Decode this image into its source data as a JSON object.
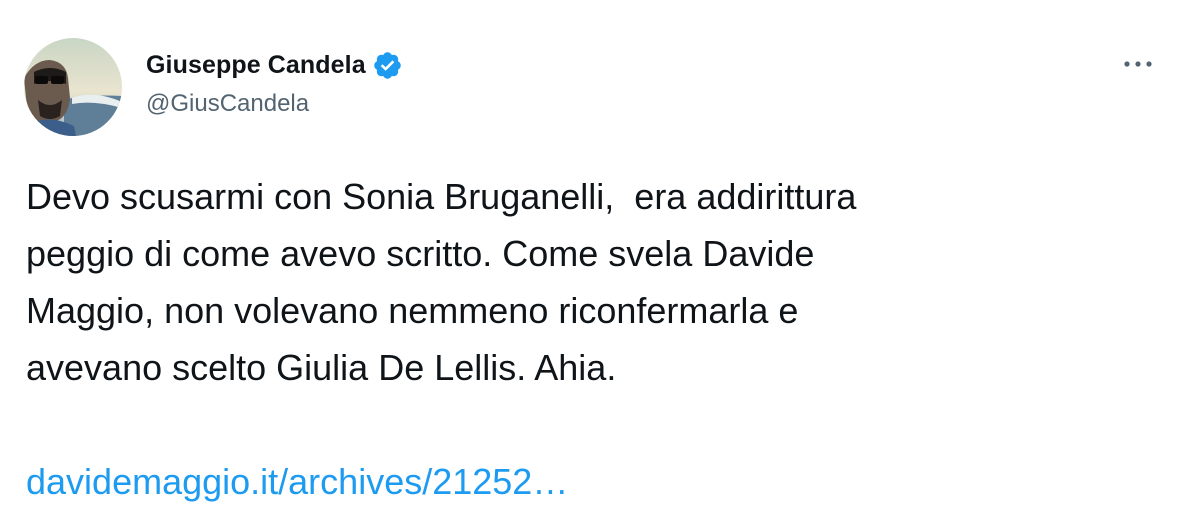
{
  "tweet": {
    "author": {
      "display_name": "Giuseppe Candela",
      "handle": "@GiusCandela",
      "verified": true,
      "avatar_icon": "profile-photo"
    },
    "more_icon": "ellipsis-icon",
    "text_lines": [
      "Devo scusarmi con Sonia Bruganelli,  era addirittura",
      "peggio di come avevo scritto. Come svela Davide",
      "Maggio, non volevano nemmeno riconfermarla e",
      "avevano scelto Giulia De Lellis. Ahia."
    ],
    "link_text": "davidemaggio.it/archives/21252…"
  },
  "colors": {
    "text": "#0f1419",
    "secondary": "#536471",
    "link": "#1d9bf0",
    "verified_badge": "#1d9bf0"
  }
}
